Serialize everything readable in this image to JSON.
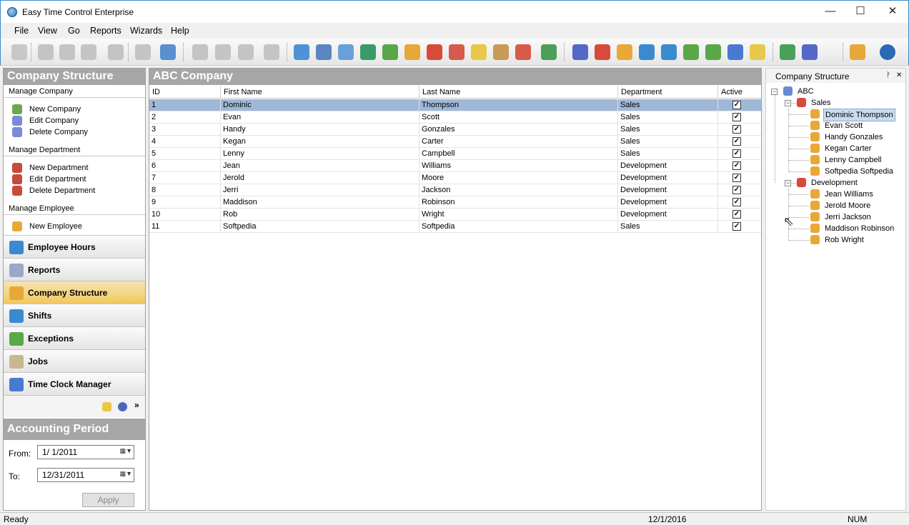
{
  "window": {
    "title": "Easy Time Control Enterprise",
    "minimize": "—",
    "maximize": "☐",
    "close": "✕"
  },
  "menu": [
    "File",
    "View",
    "Go",
    "Reports",
    "Wizards",
    "Help"
  ],
  "left": {
    "header": "Company Structure",
    "groups": [
      {
        "title": "Manage Company",
        "items": [
          "New Company",
          "Edit Company",
          "Delete Company"
        ]
      },
      {
        "title": "Manage Department",
        "items": [
          "New Department",
          "Edit Department",
          "Delete Department"
        ]
      },
      {
        "title": "Manage Employee",
        "items": [
          "New Employee"
        ]
      }
    ],
    "nav": [
      "Employee Hours",
      "Reports",
      "Company Structure",
      "Shifts",
      "Exceptions",
      "Jobs",
      "Time Clock Manager"
    ],
    "nav_more": "»",
    "accounting": {
      "header": "Accounting Period",
      "from_label": "From:",
      "from_value": "1/  1/2011",
      "to_label": "To:",
      "to_value": "12/31/2011",
      "apply": "Apply"
    }
  },
  "grid": {
    "title": "ABC Company",
    "columns": [
      "ID",
      "First Name",
      "Last Name",
      "Department",
      "Active"
    ],
    "rows": [
      {
        "id": "1",
        "first": "Dominic",
        "last": "Thompson",
        "dept": "Sales",
        "active": "✓"
      },
      {
        "id": "2",
        "first": "Evan",
        "last": "Scott",
        "dept": "Sales",
        "active": "✓"
      },
      {
        "id": "3",
        "first": "Handy",
        "last": "Gonzales",
        "dept": "Sales",
        "active": "✓"
      },
      {
        "id": "4",
        "first": "Kegan",
        "last": "Carter",
        "dept": "Sales",
        "active": "✓"
      },
      {
        "id": "5",
        "first": "Lenny",
        "last": "Campbell",
        "dept": "Sales",
        "active": "✓"
      },
      {
        "id": "6",
        "first": "Jean",
        "last": "Williams",
        "dept": "Development",
        "active": "✓"
      },
      {
        "id": "7",
        "first": "Jerold",
        "last": "Moore",
        "dept": "Development",
        "active": "✓"
      },
      {
        "id": "8",
        "first": "Jerri",
        "last": "Jackson",
        "dept": "Development",
        "active": "✓"
      },
      {
        "id": "9",
        "first": "Maddison",
        "last": "Robinson",
        "dept": "Development",
        "active": "✓"
      },
      {
        "id": "10",
        "first": "Rob",
        "last": "Wright",
        "dept": "Development",
        "active": "✓"
      },
      {
        "id": "11",
        "first": "Softpedia",
        "last": "Softpedia",
        "dept": "Sales",
        "active": "✓"
      }
    ]
  },
  "tree": {
    "header": "Company Structure",
    "pin": "ᚹ",
    "close": "✕",
    "root": "ABC",
    "departments": [
      {
        "name": "Sales",
        "employees": [
          "Dominic Thompson",
          "Evan Scott",
          "Handy Gonzales",
          "Kegan Carter",
          "Lenny Campbell",
          "Softpedia Softpedia"
        ]
      },
      {
        "name": "Development",
        "employees": [
          "Jean Williams",
          "Jerold Moore",
          "Jerri Jackson",
          "Maddison Robinson",
          "Rob Wright"
        ]
      }
    ]
  },
  "status": {
    "left": "Ready",
    "date": "12/1/2016",
    "num": "NUM"
  },
  "colors": {
    "selected_row": "#a0b8d8",
    "pane_header": "#a6a6a6",
    "window_border": "#3c88c9"
  }
}
